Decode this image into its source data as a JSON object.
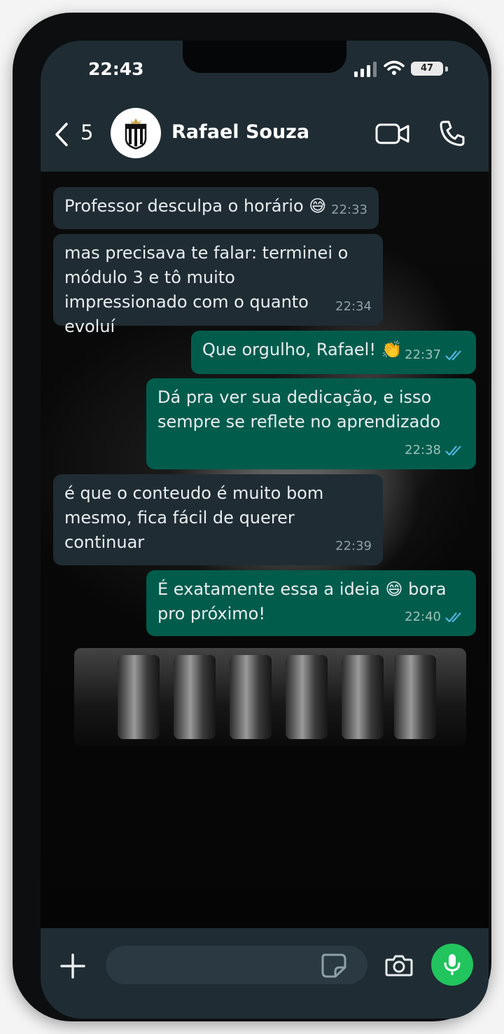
{
  "status_bar": {
    "time": "22:43",
    "battery": "47"
  },
  "header": {
    "unread_count": "5",
    "contact_name": "Rafael Souza"
  },
  "messages": [
    {
      "direction": "in",
      "text": "Professor desculpa o horário",
      "emoji": "😅",
      "time": "22:33"
    },
    {
      "direction": "in",
      "text": "mas precisava te falar: terminei o módulo 3 e tô muito impressionado com o quanto evoluí",
      "time": "22:34"
    },
    {
      "direction": "out",
      "text": "Que orgulho, Rafael!",
      "emoji": "👏",
      "time": "22:37",
      "status": "read"
    },
    {
      "direction": "out",
      "text": "Dá pra ver sua dedicação, e isso sempre se reflete no aprendizado",
      "time": "22:38",
      "status": "read"
    },
    {
      "direction": "in",
      "text": "é que o conteudo é muito bom mesmo, fica fácil de querer continuar",
      "time": "22:39"
    },
    {
      "direction": "out",
      "text": "É exatamente essa a ideia 😄 bora pro próximo!",
      "time": "22:40",
      "status": "read"
    }
  ],
  "colors": {
    "header_bg": "#1f2c33",
    "incoming_bubble": "#1f2c33",
    "outgoing_bubble": "#025c4c",
    "read_ticks": "#53bdeb",
    "mic_button": "#22c45e"
  },
  "icons": [
    "back-chevron-icon",
    "team-crest-icon",
    "video-call-icon",
    "phone-call-icon",
    "plus-icon",
    "sticker-icon",
    "camera-icon",
    "microphone-icon",
    "double-check-icon"
  ]
}
